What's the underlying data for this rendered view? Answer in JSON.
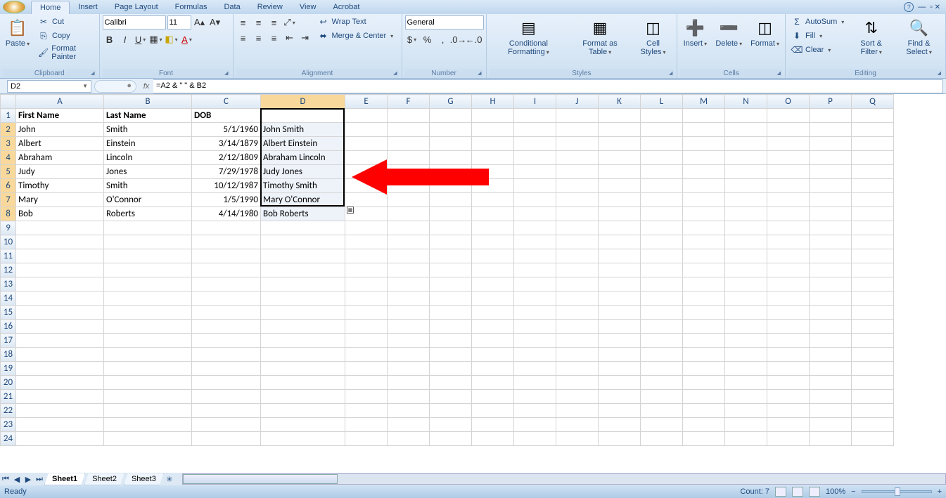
{
  "tabs": {
    "home": "Home",
    "insert": "Insert",
    "pagelayout": "Page Layout",
    "formulas": "Formulas",
    "data": "Data",
    "review": "Review",
    "view": "View",
    "acrobat": "Acrobat"
  },
  "clipboard": {
    "paste": "Paste",
    "cut": "Cut",
    "copy": "Copy",
    "format_painter": "Format Painter",
    "label": "Clipboard"
  },
  "font": {
    "name": "Calibri",
    "size": "11",
    "label": "Font"
  },
  "alignment": {
    "wrap": "Wrap Text",
    "merge": "Merge & Center",
    "label": "Alignment"
  },
  "number": {
    "format": "General",
    "label": "Number"
  },
  "styles": {
    "cond": "Conditional Formatting",
    "fmtTable": "Format as Table",
    "cellStyles": "Cell Styles",
    "label": "Styles"
  },
  "cells": {
    "insert": "Insert",
    "delete": "Delete",
    "format": "Format",
    "label": "Cells"
  },
  "editing": {
    "autosum": "AutoSum",
    "fill": "Fill",
    "clear": "Clear",
    "sort": "Sort & Filter",
    "find": "Find & Select",
    "label": "Editing"
  },
  "namebox": "D2",
  "formula": "=A2 & \" \" & B2",
  "columns": [
    "A",
    "B",
    "C",
    "D",
    "E",
    "F",
    "G",
    "H",
    "I",
    "J",
    "K",
    "L",
    "M",
    "N",
    "O",
    "P",
    "Q"
  ],
  "headers": {
    "A": "First Name",
    "B": "Last Name",
    "C": "DOB"
  },
  "rows": [
    {
      "A": "John",
      "B": "Smith",
      "C": "5/1/1960",
      "D": "John Smith"
    },
    {
      "A": "Albert",
      "B": "Einstein",
      "C": "3/14/1879",
      "D": "Albert Einstein"
    },
    {
      "A": "Abraham",
      "B": "Lincoln",
      "C": "2/12/1809",
      "D": "Abraham Lincoln"
    },
    {
      "A": "Judy",
      "B": "Jones",
      "C": "7/29/1978",
      "D": "Judy Jones"
    },
    {
      "A": "Timothy",
      "B": "Smith",
      "C": "10/12/1987",
      "D": "Timothy Smith"
    },
    {
      "A": "Mary",
      "B": "O'Connor",
      "C": "1/5/1990",
      "D": "Mary O'Connor"
    },
    {
      "A": "Bob",
      "B": "Roberts",
      "C": "4/14/1980",
      "D": "Bob Roberts"
    }
  ],
  "sheets": {
    "s1": "Sheet1",
    "s2": "Sheet2",
    "s3": "Sheet3"
  },
  "status": {
    "ready": "Ready",
    "count": "Count: 7",
    "zoom": "100%"
  }
}
